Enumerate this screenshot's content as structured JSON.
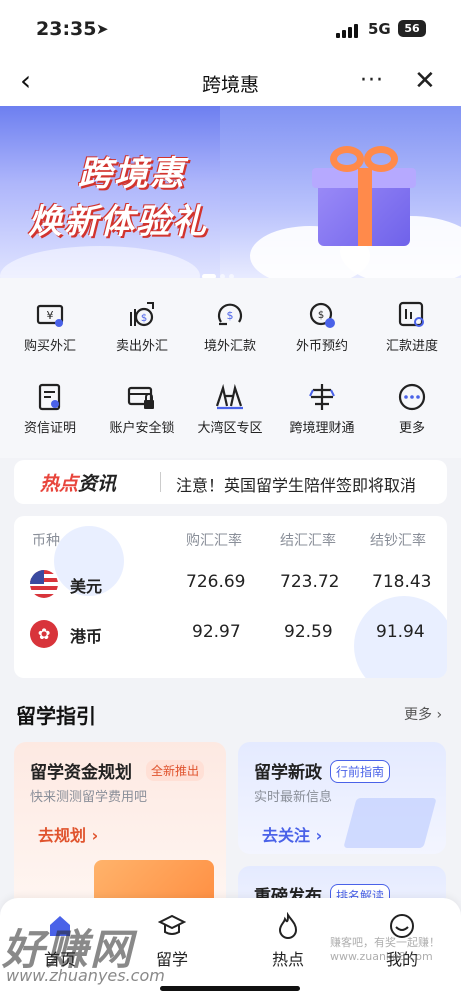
{
  "status_bar": {
    "time": "23:35",
    "network": "5G",
    "battery": "56"
  },
  "nav": {
    "back": "‹",
    "title": "跨境惠",
    "more": "···",
    "close": "✕"
  },
  "banner": {
    "line1": "跨境惠",
    "line2": "焕新体验礼"
  },
  "services": [
    {
      "label": "购买外汇",
      "icon": "buy-fx-icon"
    },
    {
      "label": "卖出外汇",
      "icon": "sell-fx-icon"
    },
    {
      "label": "境外汇款",
      "icon": "remittance-icon"
    },
    {
      "label": "外币预约",
      "icon": "reservation-icon"
    },
    {
      "label": "汇款进度",
      "icon": "progress-icon"
    },
    {
      "label": "资信证明",
      "icon": "certificate-icon"
    },
    {
      "label": "账户安全锁",
      "icon": "lock-icon"
    },
    {
      "label": "大湾区专区",
      "icon": "bay-area-icon"
    },
    {
      "label": "跨境理财通",
      "icon": "wealth-icon"
    },
    {
      "label": "更多",
      "icon": "more-icon"
    }
  ],
  "news": {
    "tag_hot": "热点",
    "tag_rest": "资讯",
    "text": "注意！英国留学生陪伴签即将取消"
  },
  "rates": {
    "headers": [
      "币种",
      "购汇汇率",
      "结汇汇率",
      "结钞汇率"
    ],
    "rows": [
      {
        "currency": "美元",
        "buy": "726.69",
        "settle": "723.72",
        "cash": "718.43"
      },
      {
        "currency": "港币",
        "buy": "92.97",
        "settle": "92.59",
        "cash": "91.94"
      }
    ]
  },
  "study": {
    "title": "留学指引",
    "more": "更多 ›",
    "cards": [
      {
        "title": "留学资金规划",
        "badge": "全新推出",
        "subtitle": "快来测测留学费用吧",
        "action": "去规划 ›"
      },
      {
        "title": "留学新政",
        "badge": "行前指南",
        "subtitle": "实时最新信息",
        "action": "去关注 ›"
      },
      {
        "title": "重磅发布",
        "badge": "排名解读"
      }
    ]
  },
  "tabs": [
    {
      "label": "首页"
    },
    {
      "label": "留学"
    },
    {
      "label": "热点"
    },
    {
      "label": "我的"
    }
  ],
  "watermark": {
    "brand": "好赚网",
    "url": "www.zhuanyes.com",
    "url2": "赚客吧，有奖一起赚！ www.zuanke8.com"
  },
  "colors": {
    "accent": "#4a62e8",
    "hot": "#e8453c",
    "orange": "#e0542e"
  }
}
